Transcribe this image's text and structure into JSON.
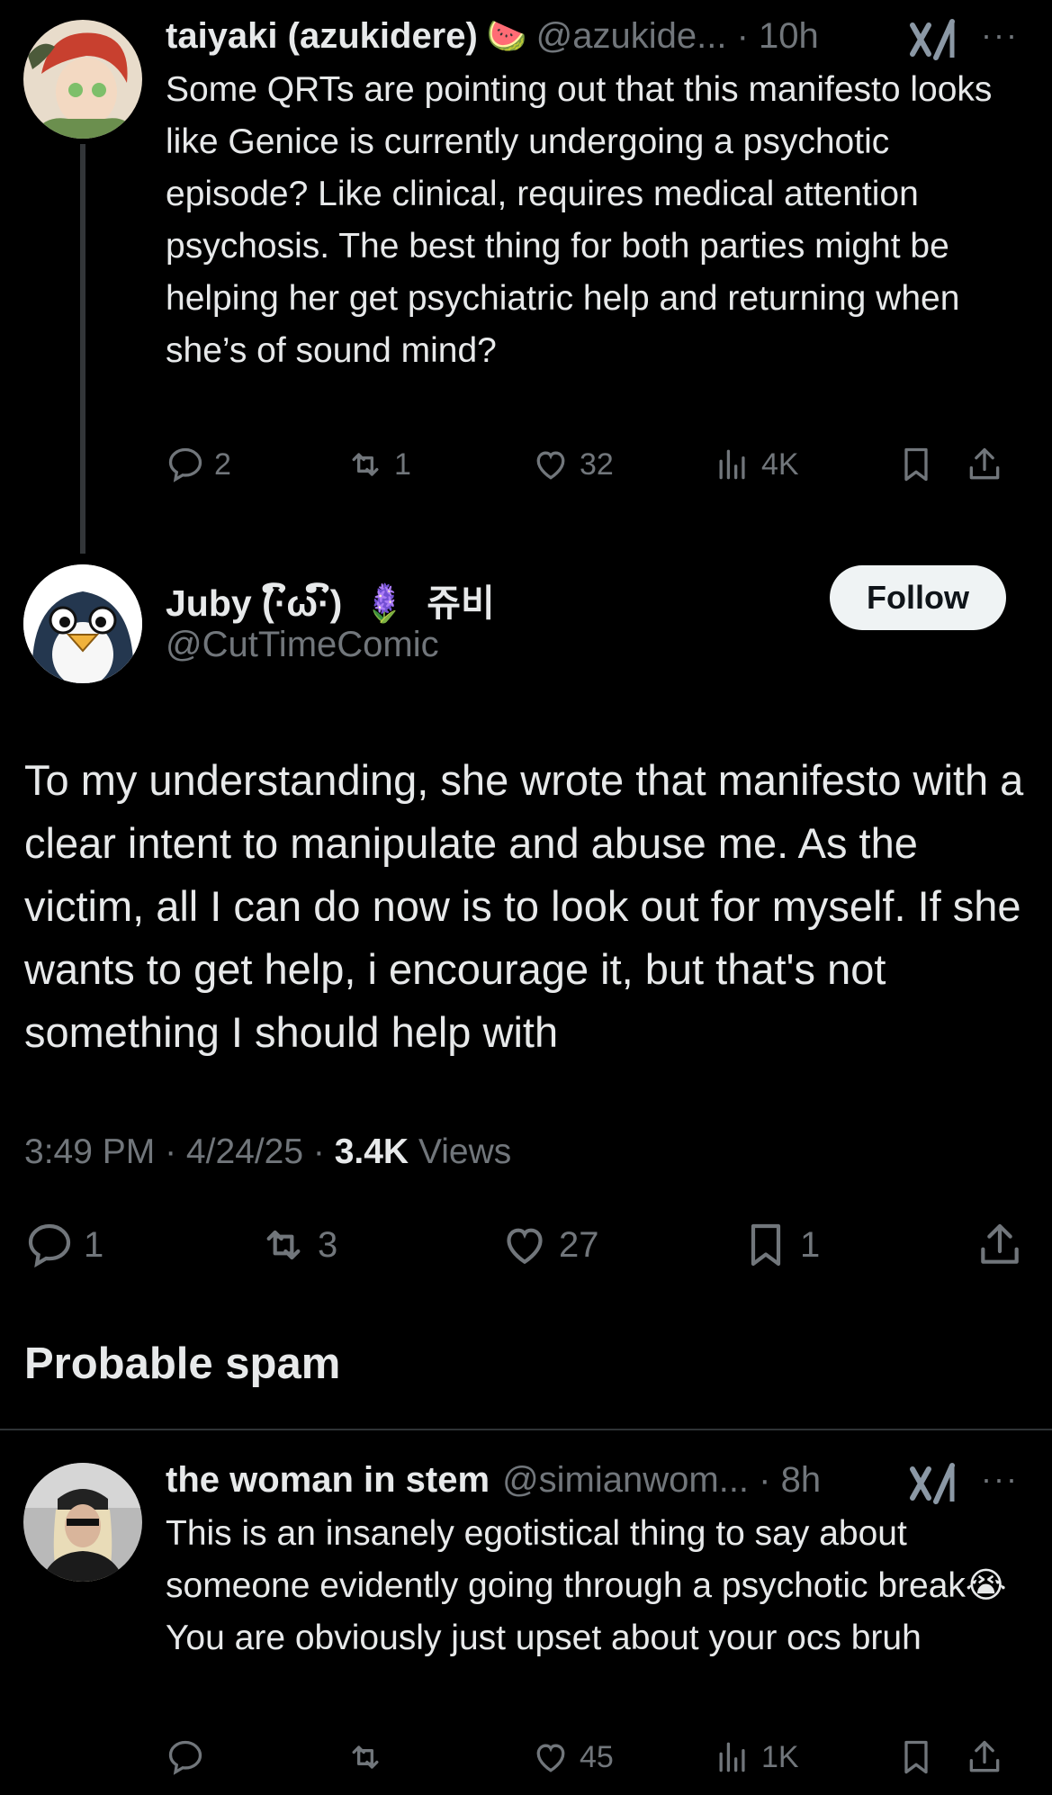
{
  "reply1": {
    "name": "taiyaki (azukidere)",
    "name_emoji": "🍉",
    "handle": "@azukide...",
    "time": "10h",
    "more": "···",
    "text": "Some QRTs are pointing out that this manifesto looks like Genice is currently undergoing a psychotic episode? Like clinical, requires medical attention psychosis. The best thing for both parties might be helping her get psychiatric help and returning when she’s of sound mind?",
    "replies": "2",
    "reposts": "1",
    "likes": "32",
    "views": "4K"
  },
  "main": {
    "name": "Juby (·ົω·ົ)",
    "name_emoji": "🪻",
    "name_korean": "쥬비",
    "handle": "@CutTimeComic",
    "follow_label": "Follow",
    "text": "To my understanding, she wrote that manifesto with a clear intent to manipulate and abuse me. As the victim, all I can do now is to look out for myself. If she wants to get help, i encourage it, but that's not something I should help with",
    "time": "3:49 PM",
    "date": "4/24/25",
    "views_count": "3.4K",
    "views_label": "Views",
    "replies": "1",
    "reposts": "3",
    "likes": "27",
    "bookmarks": "1"
  },
  "section": {
    "title": "Probable spam"
  },
  "reply2": {
    "name": "the woman in stem",
    "handle": "@simianwom...",
    "time": "8h",
    "more": "···",
    "text_before_emoji": "This is an insanely egotistical thing to say about someone evidently going through a psychotic break",
    "text_emoji": "😭",
    "text_after_emoji": " You are obviously just upset about your ocs bruh",
    "likes": "45",
    "views": "1K"
  },
  "colors": {
    "background": "#000000",
    "text": "#e7e9ea",
    "muted": "#71767b",
    "follow_bg": "#eff3f4"
  },
  "icons": [
    "reply-icon",
    "repost-icon",
    "like-icon",
    "views-icon",
    "bookmark-icon",
    "share-icon",
    "grok-icon",
    "more-icon"
  ]
}
